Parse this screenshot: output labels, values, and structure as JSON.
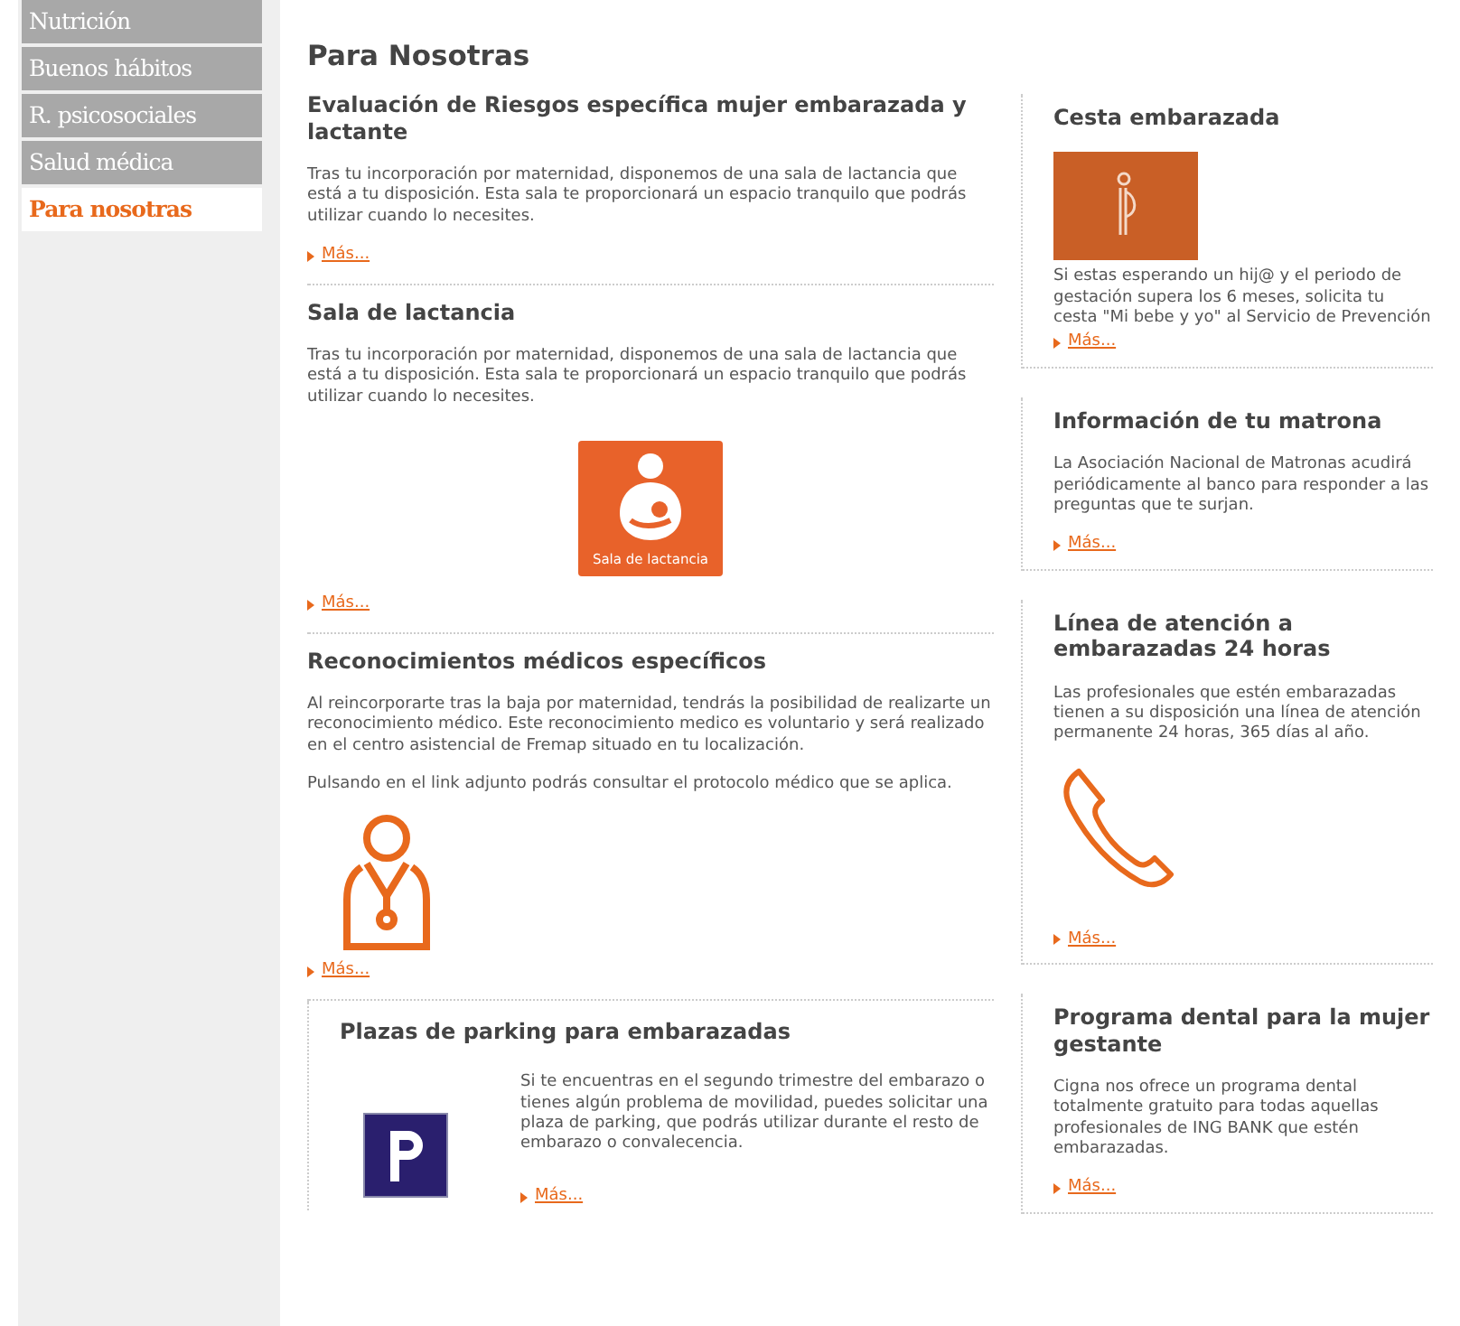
{
  "sidebar": {
    "items": [
      {
        "label": "Nutrición",
        "selected": false
      },
      {
        "label": "Buenos hábitos",
        "selected": false
      },
      {
        "label": "R. psicosociales",
        "selected": false
      },
      {
        "label": "Salud médica",
        "selected": false
      },
      {
        "label": "Para nosotras",
        "selected": true
      }
    ]
  },
  "page_title": "Para Nosotras",
  "main_sections": [
    {
      "kind": "plain",
      "title": "Evaluación de Riesgos específica mujer embarazada y lactante",
      "paragraphs": [
        "Tras tu incorporación por maternidad, disponemos de una sala de lactancia que está a tu disposición. Esta sala te proporcionará un espacio tranquilo que podrás utilizar cuando lo necesites."
      ],
      "link": "Más..."
    },
    {
      "kind": "nursing",
      "title": "Sala de lactancia",
      "paragraphs": [
        "Tras tu incorporación por maternidad, disponemos de una sala de lactancia que está a tu disposición. Esta sala te proporcionará un espacio tranquilo que podrás utilizar cuando lo necesites."
      ],
      "image_caption": "Sala de lactancia",
      "link": "Más..."
    },
    {
      "kind": "doctor",
      "title": "Reconocimientos médicos específicos",
      "paragraphs": [
        "Al reincorporarte tras la baja por maternidad, tendrás la posibilidad de realizarte un reconocimiento médico. Este reconocimiento medico es voluntario y será realizado en el centro asistencial de Fremap situado en tu localización.",
        "Pulsando en el link adjunto podrás consultar el protocolo médico que se aplica."
      ],
      "link": "Más..."
    },
    {
      "kind": "parking",
      "title": "Plazas de parking para embarazadas",
      "paragraphs": [
        "Si te encuentras en el segundo trimestre del embarazo o tienes algún problema de movilidad, puedes solicitar una plaza de parking, que podrás utilizar durante el resto de embarazo o convalecencia."
      ],
      "link": "Más..."
    }
  ],
  "side_cards": [
    {
      "kind": "pregnant",
      "title": "Cesta embarazada",
      "text": "Si estas esperando un hij@ y el periodo de gestación supera los 6 meses, solicita tu cesta \"Mi bebe y yo\" al Servicio de Prevención",
      "link": "Más..."
    },
    {
      "kind": "plain",
      "title": "Información de tu matrona",
      "text": "La Asociación Nacional de Matronas acudirá periódicamente al banco para responder a las preguntas que te surjan.",
      "link": "Más..."
    },
    {
      "kind": "phone",
      "title": "Línea de atención a embarazadas 24 horas",
      "text": "Las profesionales que estén embarazadas tienen a su disposición una línea de atención permanente 24 horas, 365 días al año.",
      "link": "Más..."
    },
    {
      "kind": "plain",
      "title": "Programa dental para la mujer gestante",
      "text": "Cigna nos ofrece un programa dental totalmente gratuito para todas aquellas profesionales de ING BANK que estén embarazadas.",
      "link": "Más..."
    }
  ]
}
